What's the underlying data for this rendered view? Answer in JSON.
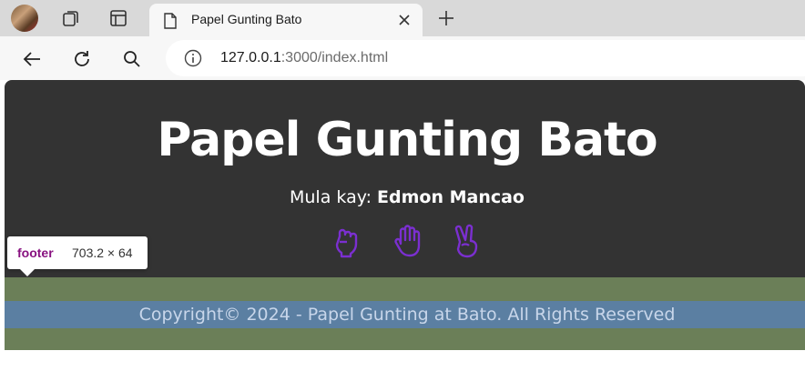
{
  "browser": {
    "tab_title": "Papel Gunting Bato",
    "url_host": "127.0.0.1",
    "url_rest": ":3000/index.html",
    "icons": [
      "profile-avatar",
      "collections-icon",
      "tab-actions-icon",
      "page-icon",
      "close-icon",
      "new-tab-icon",
      "back-icon",
      "refresh-icon",
      "search-icon",
      "info-icon"
    ]
  },
  "page": {
    "title": "Papel Gunting Bato",
    "byline_prefix": "Mula kay: ",
    "byline_author": "Edmon Mancao",
    "hand_icons": [
      "rock-hand-icon",
      "paper-hand-icon",
      "scissors-hand-icon"
    ],
    "footer_text": "Copyright© 2024 - Papel Gunting at Bato. All Rights Reserved"
  },
  "devtools_tooltip": {
    "tag": "footer",
    "size": "703.2 × 64"
  },
  "colors": {
    "header_bg": "#333333",
    "footer_margin": "#6b7f58",
    "footer_content": "#5b7fa2",
    "icon_accent": "#7b2fd0",
    "tooltip_tag": "#881280"
  }
}
